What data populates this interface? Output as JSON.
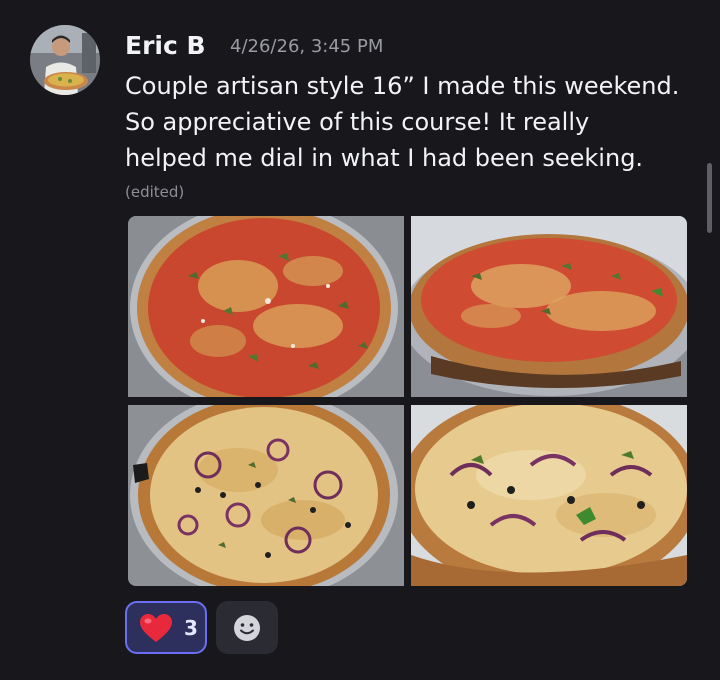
{
  "message": {
    "author": "Eric B",
    "timestamp": "4/26/26, 3:45 PM",
    "text_lines": [
      "Couple artisan style 16” I made this weekend.",
      "So appreciative of this course! It really",
      "helped me dial in what I had been seeking."
    ],
    "edited_label": "(edited)",
    "attachments": [
      {
        "icon": "pizza-photo"
      },
      {
        "icon": "pizza-photo"
      },
      {
        "icon": "pizza-photo"
      },
      {
        "icon": "pizza-photo"
      }
    ]
  },
  "reactions": [
    {
      "icon": "red-heart-icon",
      "count": "3",
      "selected": true
    }
  ],
  "add_reaction": {
    "icon": "smiley-add-reaction-icon"
  },
  "colors": {
    "background": "#17171c",
    "text": "#f2f3f5",
    "muted": "#9a9ba3",
    "reaction_border": "#6d6ff2",
    "reaction_bg": "#2d2f5c",
    "heart": "#e8293b"
  }
}
